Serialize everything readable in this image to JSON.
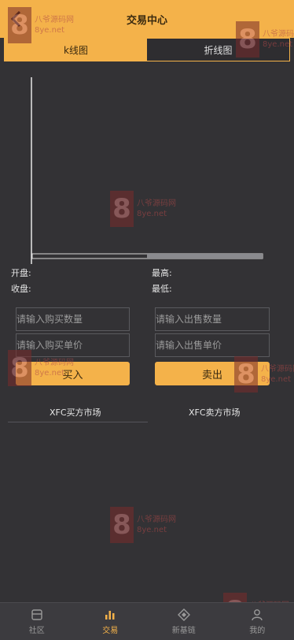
{
  "header": {
    "title": "交易中心",
    "back_icon": "back-icon"
  },
  "tabs": [
    {
      "label": "k线图",
      "active": true
    },
    {
      "label": "折线图",
      "active": false
    }
  ],
  "stats": {
    "open_label": "开盘:",
    "close_label": "收盘:",
    "high_label": "最高:",
    "low_label": "最低:"
  },
  "buy": {
    "qty_placeholder": "请输入购买数量",
    "price_placeholder": "请输入购买单价",
    "button": "买入",
    "market": "XFC买方市场"
  },
  "sell": {
    "qty_placeholder": "请输入出售数量",
    "price_placeholder": "请输入出售单价",
    "button": "卖出",
    "market": "XFC卖方市场"
  },
  "tabbar": [
    {
      "label": "社区",
      "icon": "community-icon",
      "active": false
    },
    {
      "label": "交易",
      "icon": "trade-chart-icon",
      "active": true
    },
    {
      "label": "新基链",
      "icon": "diamond-icon",
      "active": false
    },
    {
      "label": "我的",
      "icon": "user-icon",
      "active": false
    }
  ],
  "watermark": {
    "digit": "8",
    "line1": "八爷源码网",
    "line2": "8ye.net"
  },
  "colors": {
    "accent": "#f4b24a",
    "background": "#333235"
  }
}
